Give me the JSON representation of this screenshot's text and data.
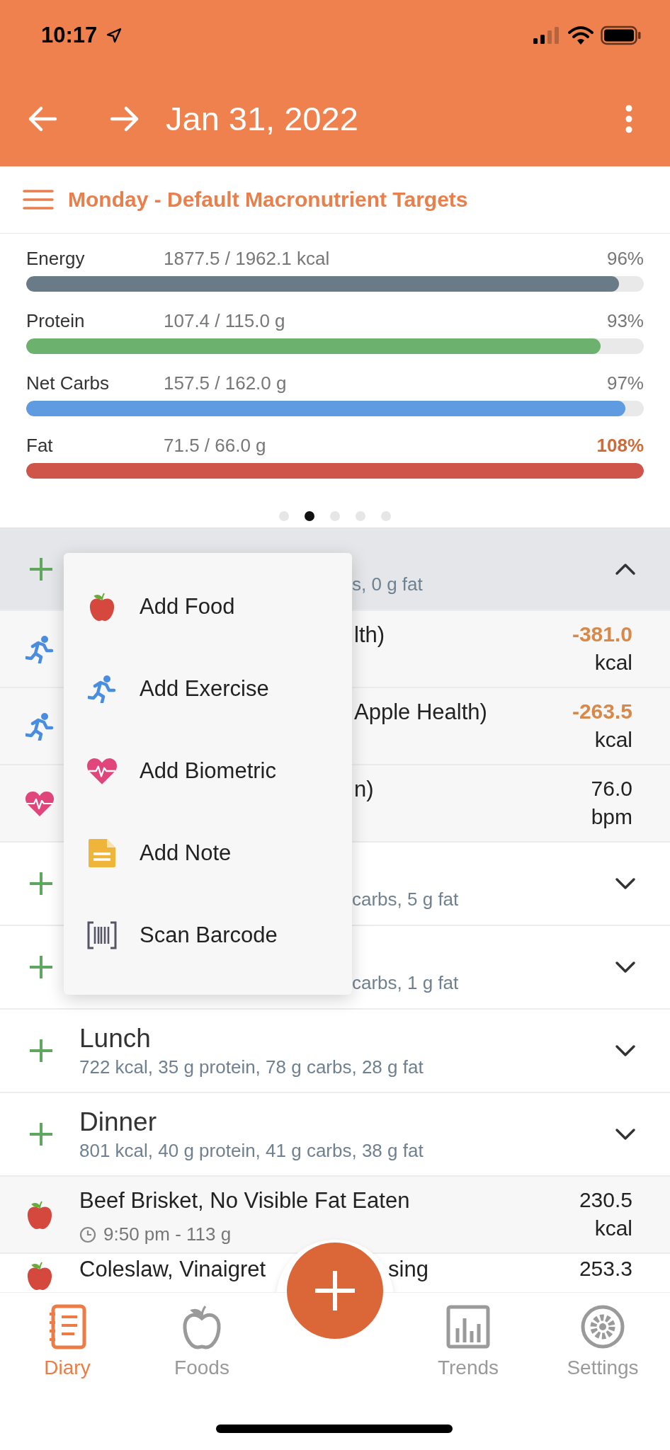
{
  "status_bar": {
    "time": "10:17"
  },
  "header": {
    "title": "Jan 31, 2022"
  },
  "targets": {
    "label": "Monday - Default Macronutrient Targets"
  },
  "macros": [
    {
      "name": "Energy",
      "reading": "1877.5 / 1962.1 kcal",
      "percent": "96%",
      "level": 0.96,
      "color": "#6a7b88",
      "over": false
    },
    {
      "name": "Protein",
      "reading": "107.4 / 115.0 g",
      "percent": "93%",
      "level": 0.93,
      "color": "#6cb26e",
      "over": false
    },
    {
      "name": "Net Carbs",
      "reading": "157.5 / 162.0 g",
      "percent": "97%",
      "level": 0.97,
      "color": "#5f9be0",
      "over": false
    },
    {
      "name": "Fat",
      "reading": "71.5 / 66.0 g",
      "percent": "108%",
      "level": 1,
      "color": "#cf554b",
      "over": true
    }
  ],
  "pager": [
    {
      "selected": false
    },
    {
      "selected": true
    },
    {
      "selected": false
    },
    {
      "selected": false
    },
    {
      "selected": false
    }
  ],
  "diary": [
    {
      "kind": "group",
      "summary": "s, 0 g fat",
      "expanded": true
    },
    {
      "kind": "exercise",
      "name": "lth)",
      "amount": "-381.0",
      "unit": "kcal",
      "burned": true
    },
    {
      "kind": "exercise",
      "name": "Apple Health)",
      "amount": "-263.5",
      "unit": "kcal",
      "burned": true
    },
    {
      "kind": "biometric",
      "name": "n)",
      "amount": "76.0",
      "unit": "bpm",
      "burned": false
    },
    {
      "kind": "group",
      "summary": "carbs, 5 g fat",
      "expanded": false
    },
    {
      "kind": "group",
      "summary": "carbs, 1 g fat",
      "expanded": false
    },
    {
      "kind": "group",
      "title": "Lunch",
      "summary": "722 kcal, 35 g protein, 78 g carbs, 28 g fat",
      "expanded": false
    },
    {
      "kind": "group",
      "title": "Dinner",
      "summary": "801 kcal, 40 g protein, 41 g carbs, 38 g fat",
      "expanded": false
    },
    {
      "kind": "food",
      "name": "Beef Brisket, No Visible Fat Eaten",
      "detail": "9:50 pm - 113 g",
      "amount": "230.5",
      "unit": "kcal",
      "burned": false
    },
    {
      "kind": "food",
      "name": "Coleslaw, Vinaigret",
      "name_after": "sing",
      "amount": "253.3",
      "burned": false
    }
  ],
  "add_menu": [
    {
      "label": "Add Food",
      "kind": "food"
    },
    {
      "label": "Add Exercise",
      "kind": "exercise"
    },
    {
      "label": "Add Biometric",
      "kind": "biometric"
    },
    {
      "label": "Add Note",
      "kind": "note"
    },
    {
      "label": "Scan Barcode",
      "kind": "barcode"
    }
  ],
  "tabs": [
    {
      "label": "Diary",
      "kind": "diary",
      "selected": true
    },
    {
      "label": "Foods",
      "kind": "foods",
      "selected": false
    },
    {
      "label": "Trends",
      "kind": "trends",
      "selected": false
    },
    {
      "label": "Settings",
      "kind": "settings",
      "selected": false
    }
  ]
}
